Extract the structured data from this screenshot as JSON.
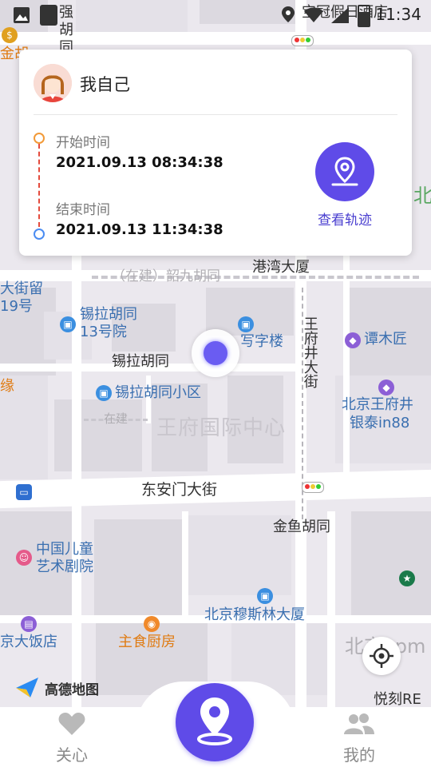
{
  "status_bar": {
    "time": "11:34"
  },
  "map": {
    "labels": {
      "gangwan": "港湾大厦",
      "xila_13": "锡拉胡同",
      "xila_13b": "13号院",
      "xilahutong": "锡拉胡同",
      "xila_xiaoqu": "锡拉胡同小区",
      "xiezilou": "写字楼",
      "tanmujiang": "谭木匠",
      "wangfujing_street": "王府井大街",
      "wangfu_center": "王府国际中心",
      "yintai_1": "北京王府井",
      "yintai_2": "银泰in88",
      "dongan": "东安门大街",
      "jinyu": "金鱼胡同",
      "children_1": "中国儿童",
      "children_2": "艺术剧院",
      "muslim": "北京穆斯林大厦",
      "zhushi": "主食厨房",
      "hotel": "京大饭店",
      "yueke": "悦刻RE",
      "shaojiu": "（在建）韶九胡同",
      "dajie_19": "19号",
      "jieshao": "大街留",
      "zaijian": "在建",
      "bei": "北",
      "jiu_dian": "宝冠假日酒店",
      "qiang": "强",
      "hu": "胡",
      "tong": "同",
      "jinhu": "金胡",
      "beijing_app": "北京apm",
      "yuan": "缘"
    },
    "amap_logo": "高德地图"
  },
  "card": {
    "user_name": "我自己",
    "start_label": "开始时间",
    "start_time": "2021.09.13 08:34:38",
    "end_label": "结束时间",
    "end_time": "2021.09.13 11:34:38",
    "track_button": "查看轨迹"
  },
  "nav": {
    "care": "关心",
    "mine": "我的"
  },
  "colors": {
    "accent": "#5f4be8",
    "start_dot": "#f29a38",
    "end_dot": "#4a8cf2",
    "track_line": "#e44a3c"
  }
}
